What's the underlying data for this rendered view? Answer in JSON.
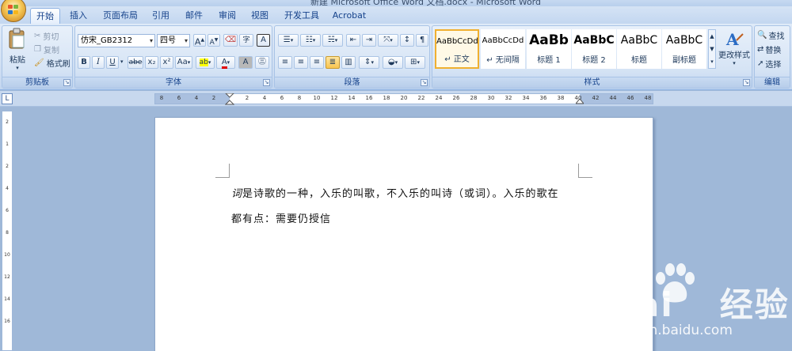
{
  "window": {
    "title": "新建 Microsoft Office Word 文档.docx - Microsoft Word"
  },
  "tabs": [
    "开始",
    "插入",
    "页面布局",
    "引用",
    "邮件",
    "审阅",
    "视图",
    "开发工具",
    "Acrobat"
  ],
  "clipboard": {
    "paste": "粘贴",
    "cut": "剪切",
    "copy": "复制",
    "format_painter": "格式刷",
    "label": "剪贴板"
  },
  "font": {
    "name": "仿宋_GB2312",
    "size": "四号",
    "label": "字体",
    "grow": "A",
    "shrink": "A",
    "bold": "B",
    "italic": "I",
    "underline": "U",
    "strike": "abe",
    "subscript": "x₂",
    "superscript": "x²",
    "change_case": "Aa",
    "highlight": "ab",
    "color": "A",
    "shading": "A",
    "char_border": "A",
    "phonetic": "字"
  },
  "paragraph": {
    "label": "段落"
  },
  "styles": {
    "label": "样式",
    "items": [
      {
        "sample": "AaBbCcDd",
        "name": "↵ 正文"
      },
      {
        "sample": "AaBbCcDd",
        "name": "↵ 无间隔"
      },
      {
        "sample": "AaBb",
        "name": "标题 1"
      },
      {
        "sample": "AaBbC",
        "name": "标题 2"
      },
      {
        "sample": "AaBbC",
        "name": "标题"
      },
      {
        "sample": "AaBbC",
        "name": "副标题"
      }
    ],
    "change": "更改样式"
  },
  "editing": {
    "label": "编辑",
    "find": "查找",
    "replace": "替换",
    "select": "选择"
  },
  "ruler": {
    "corner": "L",
    "left_numbers": [
      "8",
      "6",
      "4",
      "2"
    ],
    "right_numbers": [
      "2",
      "4",
      "6",
      "8",
      "10",
      "12",
      "14",
      "16",
      "18",
      "20",
      "22",
      "24",
      "26",
      "28",
      "30",
      "32",
      "34",
      "36",
      "38",
      "40",
      "42",
      "44",
      "46",
      "48"
    ],
    "v_numbers": [
      "2",
      "1",
      "2",
      "4",
      "6",
      "8",
      "10",
      "12",
      "14",
      "16"
    ]
  },
  "document": {
    "line1_emphasis": "词",
    "line1_rest": "是诗歌的一种，入乐的叫歌，不入乐的叫诗（或词）。入乐的歌在",
    "line2": "都有点：需要仍授信"
  },
  "watermark": {
    "logo_left": "Bai",
    "logo_right": "经验",
    "url": "jingyan.baidu.com"
  },
  "colors": {
    "accent": "#15428b",
    "ribbon": "#dfeaf8",
    "workspace": "#9fb8d8",
    "highlight_yellow": "#ffff00",
    "font_red": "#e00000"
  }
}
